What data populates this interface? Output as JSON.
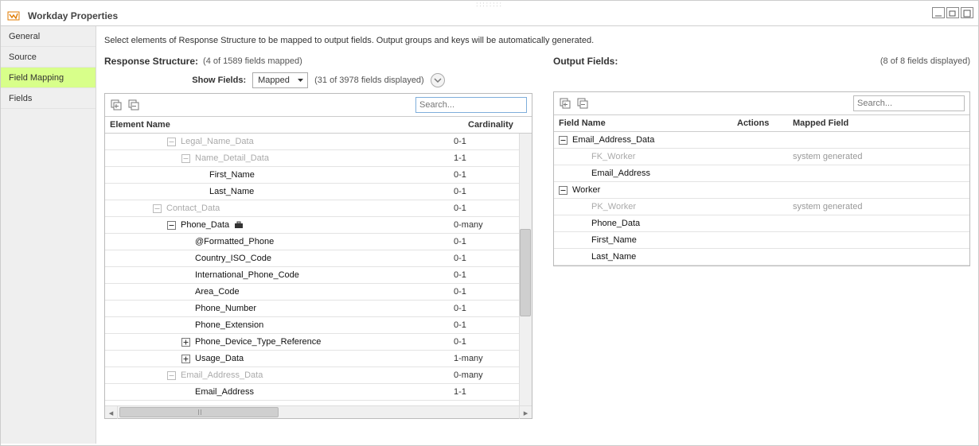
{
  "window": {
    "title": "Workday Properties"
  },
  "sidebar": {
    "items": [
      {
        "label": "General"
      },
      {
        "label": "Source"
      },
      {
        "label": "Field Mapping",
        "active": true
      },
      {
        "label": "Fields"
      }
    ]
  },
  "desc": "Select elements of Response Structure to be mapped to output fields. Output groups and keys will be automatically generated.",
  "left": {
    "title": "Response Structure:",
    "mapped_summary": "(4 of 1589 fields mapped)",
    "show_fields_label": "Show Fields:",
    "show_fields_value": "Mapped",
    "displayed_summary": "(31 of 3978 fields displayed)",
    "search_placeholder": "Search...",
    "headers": {
      "name": "Element Name",
      "card": "Cardinality"
    },
    "rows": [
      {
        "indent": 4,
        "toggle": "minus",
        "dim": true,
        "label": "Legal_Name_Data",
        "card": "0-1"
      },
      {
        "indent": 5,
        "toggle": "minus",
        "dim": true,
        "label": "Name_Detail_Data",
        "card": "1-1"
      },
      {
        "indent": 6,
        "toggle": null,
        "dim": false,
        "label": "First_Name",
        "card": "0-1"
      },
      {
        "indent": 6,
        "toggle": null,
        "dim": false,
        "label": "Last_Name",
        "card": "0-1"
      },
      {
        "indent": 3,
        "toggle": "minus",
        "dim": true,
        "label": "Contact_Data",
        "card": "0-1"
      },
      {
        "indent": 4,
        "toggle": "minus",
        "dim": false,
        "label": "Phone_Data",
        "card": "0-many",
        "suitcase": true
      },
      {
        "indent": 5,
        "toggle": null,
        "dim": false,
        "label": "@Formatted_Phone",
        "card": "0-1"
      },
      {
        "indent": 5,
        "toggle": null,
        "dim": false,
        "label": "Country_ISO_Code",
        "card": "0-1"
      },
      {
        "indent": 5,
        "toggle": null,
        "dim": false,
        "label": "International_Phone_Code",
        "card": "0-1"
      },
      {
        "indent": 5,
        "toggle": null,
        "dim": false,
        "label": "Area_Code",
        "card": "0-1"
      },
      {
        "indent": 5,
        "toggle": null,
        "dim": false,
        "label": "Phone_Number",
        "card": "0-1"
      },
      {
        "indent": 5,
        "toggle": null,
        "dim": false,
        "label": "Phone_Extension",
        "card": "0-1"
      },
      {
        "indent": 5,
        "toggle": "plus",
        "dim": false,
        "label": "Phone_Device_Type_Reference",
        "card": "0-1"
      },
      {
        "indent": 5,
        "toggle": "plus",
        "dim": false,
        "label": "Usage_Data",
        "card": "1-many"
      },
      {
        "indent": 4,
        "toggle": "minus",
        "dim": true,
        "label": "Email_Address_Data",
        "card": "0-many"
      },
      {
        "indent": 5,
        "toggle": null,
        "dim": false,
        "label": "Email_Address",
        "card": "1-1"
      }
    ]
  },
  "right": {
    "title": "Output Fields:",
    "displayed_summary": "(8 of 8 fields displayed)",
    "search_placeholder": "Search...",
    "headers": {
      "name": "Field Name",
      "actions": "Actions",
      "mapped": "Mapped Field"
    },
    "rows": [
      {
        "indent": 0,
        "toggle": "minus",
        "dim": false,
        "label": "Email_Address_Data",
        "mapped": ""
      },
      {
        "indent": 1,
        "toggle": null,
        "dim": true,
        "label": "FK_Worker",
        "mapped": "system generated"
      },
      {
        "indent": 1,
        "toggle": null,
        "dim": false,
        "label": "Email_Address",
        "mapped": ""
      },
      {
        "indent": 0,
        "toggle": "minus",
        "dim": false,
        "label": "Worker",
        "mapped": ""
      },
      {
        "indent": 1,
        "toggle": null,
        "dim": true,
        "label": "PK_Worker",
        "mapped": "system generated"
      },
      {
        "indent": 1,
        "toggle": null,
        "dim": false,
        "label": "Phone_Data",
        "mapped": ""
      },
      {
        "indent": 1,
        "toggle": null,
        "dim": false,
        "label": "First_Name",
        "mapped": ""
      },
      {
        "indent": 1,
        "toggle": null,
        "dim": false,
        "label": "Last_Name",
        "mapped": ""
      }
    ]
  }
}
